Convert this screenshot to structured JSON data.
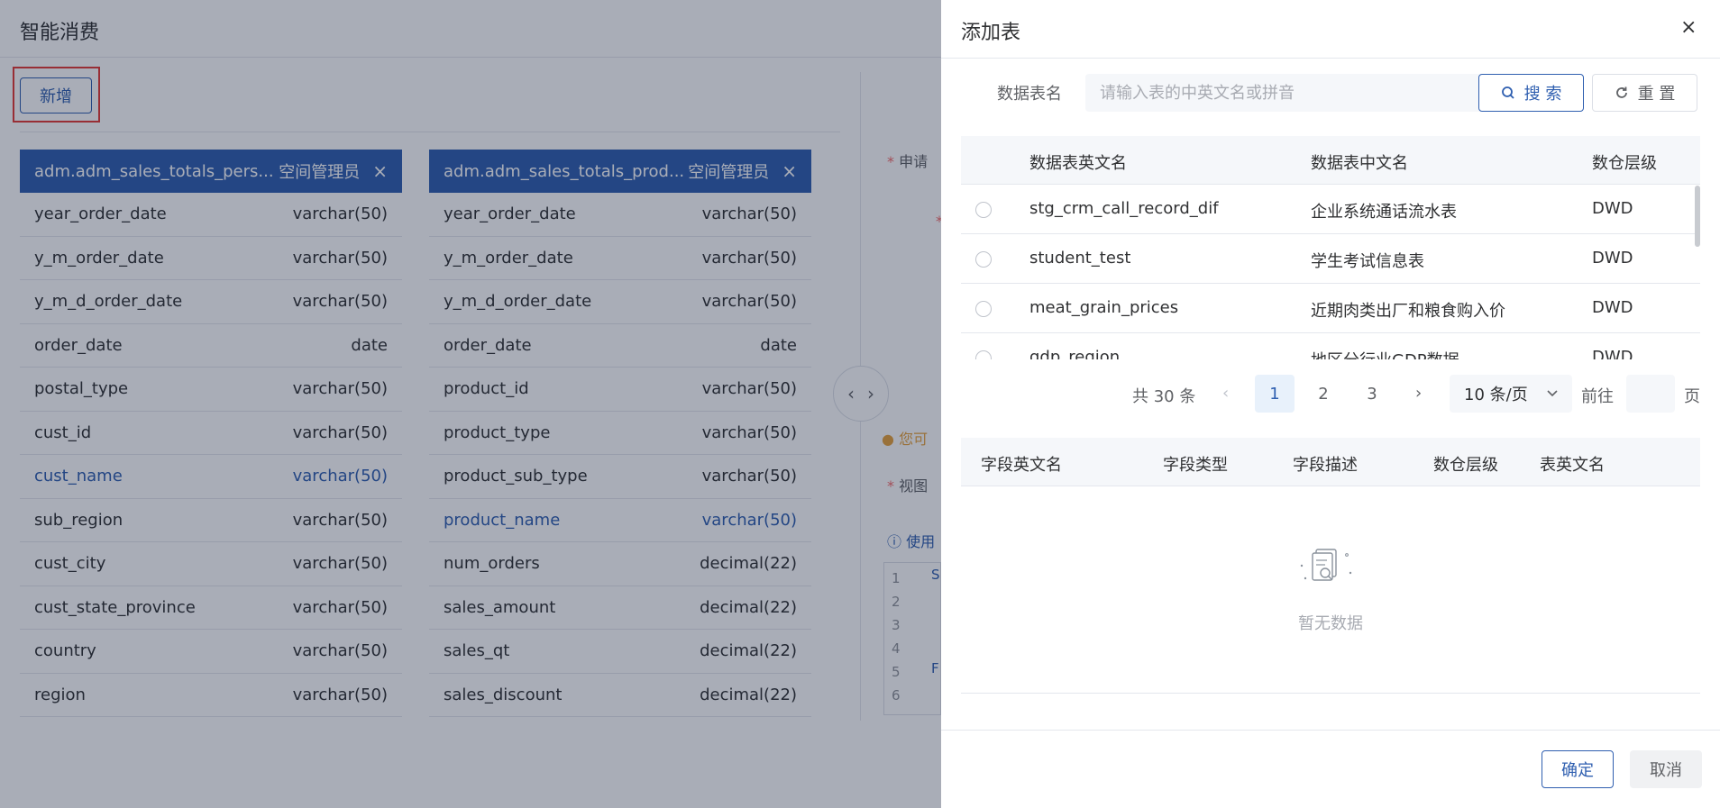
{
  "background": {
    "title": "智能消费",
    "add_button": "新增",
    "cards": [
      {
        "name": "adm.adm_sales_totals_pers...",
        "owner": "空间管理员",
        "close_glyph": "×",
        "rows": [
          {
            "field": "year_order_date",
            "type": "varchar(50)"
          },
          {
            "field": "y_m_order_date",
            "type": "varchar(50)"
          },
          {
            "field": "y_m_d_order_date",
            "type": "varchar(50)"
          },
          {
            "field": "order_date",
            "type": "date"
          },
          {
            "field": "postal_type",
            "type": "varchar(50)"
          },
          {
            "field": "cust_id",
            "type": "varchar(50)"
          },
          {
            "field": "cust_name",
            "type": "varchar(50)"
          },
          {
            "field": "sub_region",
            "type": "varchar(50)"
          },
          {
            "field": "cust_city",
            "type": "varchar(50)"
          },
          {
            "field": "cust_state_province",
            "type": "varchar(50)"
          },
          {
            "field": "country",
            "type": "varchar(50)"
          },
          {
            "field": "region",
            "type": "varchar(50)"
          }
        ]
      },
      {
        "name": "adm.adm_sales_totals_prod...",
        "owner": "空间管理员",
        "close_glyph": "×",
        "rows": [
          {
            "field": "year_order_date",
            "type": "varchar(50)"
          },
          {
            "field": "y_m_order_date",
            "type": "varchar(50)"
          },
          {
            "field": "y_m_d_order_date",
            "type": "varchar(50)"
          },
          {
            "field": "order_date",
            "type": "date"
          },
          {
            "field": "product_id",
            "type": "varchar(50)"
          },
          {
            "field": "product_type",
            "type": "varchar(50)"
          },
          {
            "field": "product_sub_type",
            "type": "varchar(50)"
          },
          {
            "field": "product_name",
            "type": "varchar(50)"
          },
          {
            "field": "num_orders",
            "type": "decimal(22)"
          },
          {
            "field": "sales_amount",
            "type": "decimal(22)"
          },
          {
            "field": "sales_qt",
            "type": "decimal(22)"
          },
          {
            "field": "sales_discount",
            "type": "decimal(22)"
          }
        ]
      }
    ],
    "side": {
      "apply_label": "申请",
      "notice": "您可",
      "view_label": "视图",
      "use_label": "使用",
      "code_lines": [
        "1",
        "2",
        "3",
        "4",
        "5",
        "6"
      ],
      "code_letters": [
        "S",
        "F"
      ]
    },
    "collapse_left": "‹",
    "collapse_right": "›"
  },
  "drawer": {
    "title": "添加表",
    "close_glyph": "×",
    "search": {
      "label": "数据表名",
      "placeholder": "请输入表的中英文名或拼音",
      "search_button": "搜 索",
      "reset_button": "重 置"
    },
    "table": {
      "columns": [
        "数据表英文名",
        "数据表中文名",
        "数仓层级"
      ],
      "rows": [
        {
          "en": "stg_crm_call_record_dif",
          "cn": "企业系统通话流水表",
          "layer": "DWD"
        },
        {
          "en": "student_test",
          "cn": "学生考试信息表",
          "layer": "DWD"
        },
        {
          "en": "meat_grain_prices",
          "cn": "近期肉类出厂和粮食购入价",
          "layer": "DWD"
        },
        {
          "en": "gdp_region",
          "cn": "地区分行业GDP数据",
          "layer": "DWD"
        }
      ]
    },
    "pagination": {
      "total": "共 30 条",
      "prev": "‹",
      "pages": [
        "1",
        "2",
        "3"
      ],
      "next": "›",
      "page_size": "10 条/页",
      "goto": "前往",
      "unit": "页"
    },
    "fields_table": {
      "columns": [
        "字段英文名",
        "字段类型",
        "字段描述",
        "数仓层级",
        "表英文名"
      ],
      "empty_text": "暂无数据"
    },
    "footer": {
      "ok": "确定",
      "cancel": "取消"
    }
  }
}
